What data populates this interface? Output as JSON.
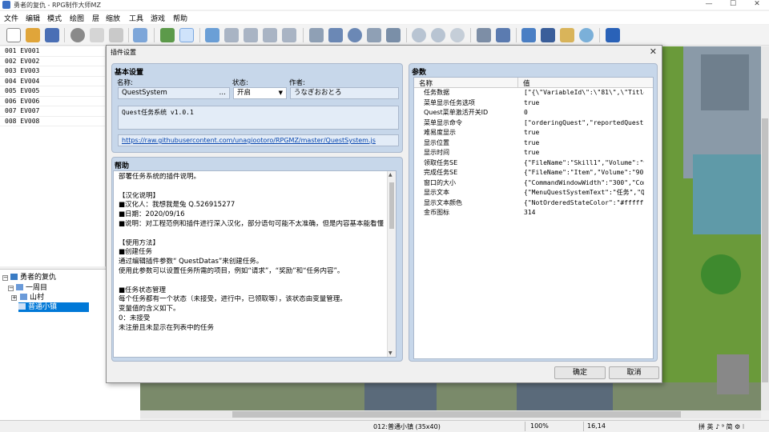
{
  "window": {
    "title": "勇者的复仇 - RPG制作大师MZ",
    "controls": [
      "—",
      "☐",
      "✕"
    ]
  },
  "menu": [
    "文件",
    "编辑",
    "模式",
    "绘图",
    "层",
    "缩放",
    "工具",
    "游戏",
    "帮助"
  ],
  "toolbar_icons": [
    "new-project-icon",
    "open-project-icon",
    "save-project-icon",
    "cut-icon",
    "copy-icon",
    "paste-icon",
    "undo-icon",
    "map-mode-icon",
    "event-mode-icon",
    "layer-1-icon",
    "layer-2-icon",
    "layer-3-icon",
    "layer-4-icon",
    "layer-5-icon",
    "pencil-icon",
    "rectangle-icon",
    "ellipse-icon",
    "fill-icon",
    "shadow-pen-icon",
    "zoom-in-icon",
    "zoom-out-icon",
    "zoom-actual-icon",
    "database-icon",
    "plugin-manager-icon",
    "sound-test-icon",
    "event-searcher-icon",
    "resource-manager-icon",
    "character-generator-icon",
    "playtest-icon"
  ],
  "events": [
    "001 EV001",
    "002 EV002",
    "003 EV003",
    "004 EV004",
    "005 EV005",
    "006 EV006",
    "007 EV007",
    "008 EV008"
  ],
  "maptree": {
    "project": "勇者的复仇",
    "group": "一周目",
    "map1": "山村",
    "map2": "普通小镇"
  },
  "dialog": {
    "title": "插件设置",
    "close": "✕",
    "basic_title": "基本设置",
    "name_label": "名称:",
    "name_value": "QuestSystem",
    "name_button": "…",
    "status_label": "状态:",
    "status_value": "开启",
    "author_label": "作者:",
    "author_value": "うなぎおおとろ",
    "description": "Quest任务系统 v1.0.1",
    "url": "https://raw.githubusercontent.com/unagiootoro/RPGMZ/master/QuestSystem.js",
    "help_title": "帮助",
    "help_lines": [
      "部署任务系统的插件说明。",
      "",
      "【汉化说明】",
      "■汉化人：我想我是兔 Q.526915277",
      "■日期：2020/09/16",
      "■说明：对工程范例和插件进行深入汉化，部分语句可能不太准确，但是内容基本能看懂",
      "",
      "【使用方法】",
      "■创建任务",
      "通过编辑插件参数“ QuestDatas”来创建任务。",
      "使用此参数可以设置任务所需的项目，例如“请求”，“奖励”和“任务内容”。",
      "",
      "■任务状态管理",
      "每个任务都有一个状态（未接受，进行中，已领取等），该状态由变量管理。",
      "变量值的含义如下。",
      "0：未接受",
      "未注册且未显示在列表中的任务"
    ],
    "params_title": "参数",
    "col_name": "名称",
    "col_value": "值",
    "params": [
      {
        "name": "任务数据",
        "value": "[\"{\\\"VariableId\\\":\\\"81\\\",\\\"Title\\\"..."
      },
      {
        "name": "菜单显示任务选项",
        "value": "true"
      },
      {
        "name": "Quest菜单激活开关ID",
        "value": "0"
      },
      {
        "name": "菜单显示命令",
        "value": "[\"orderingQuest\",\"reportedQuest\"..."
      },
      {
        "name": "难易度显示",
        "value": "true"
      },
      {
        "name": "显示位置",
        "value": "true"
      },
      {
        "name": "显示时间",
        "value": "true"
      },
      {
        "name": "领取任务SE",
        "value": "{\"FileName\":\"Skill1\",\"Volume\":\"9..."
      },
      {
        "name": "完成任务SE",
        "value": "{\"FileName\":\"Item\",\"Volume\":\"90\"..."
      },
      {
        "name": "窗口的大小",
        "value": "{\"CommandWindowWidth\":\"300\",\"Com..."
      },
      {
        "name": "显示文本",
        "value": "{\"MenuQuestSystemText\":\"任务\",\"Q..."
      },
      {
        "name": "显示文本颜色",
        "value": "{\"NotOrderedStateColor\":\"#ffffff..."
      },
      {
        "name": "金币图标",
        "value": "314"
      }
    ],
    "ok": "确定",
    "cancel": "取消"
  },
  "status": {
    "map": "012:普通小镇 (35x40)",
    "zoom": "100%",
    "coords": "16,14"
  },
  "ime": "拼 英 ♪ ⁹ 简 ⚙ ⁝"
}
